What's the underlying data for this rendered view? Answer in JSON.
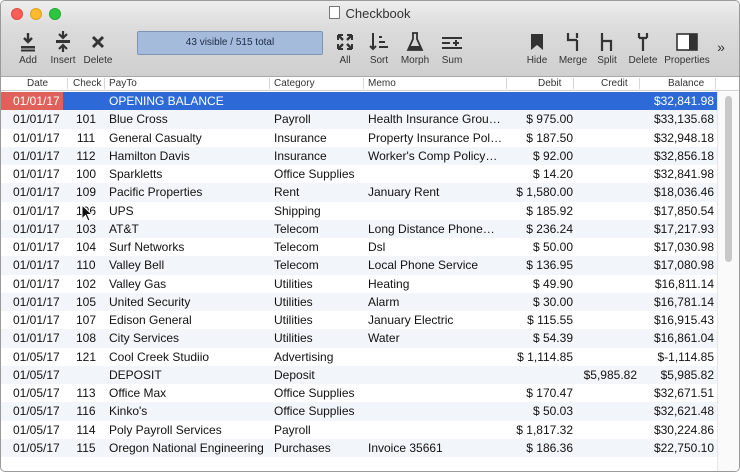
{
  "window": {
    "title": "Checkbook"
  },
  "toolbar": {
    "add": "Add",
    "insert": "Insert",
    "delete": "Delete",
    "status": "43 visible / 515 total",
    "all": "All",
    "sort": "Sort",
    "morph": "Morph",
    "sum": "Sum",
    "hide": "Hide",
    "merge": "Merge",
    "split": "Split",
    "delete2": "Delete",
    "properties": "Properties",
    "overflow": "»"
  },
  "columns": {
    "date": "Date",
    "check": "Check",
    "payto": "PayTo",
    "category": "Category",
    "memo": "Memo",
    "debit": "Debit",
    "credit": "Credit",
    "balance": "Balance"
  },
  "rows": [
    {
      "date": "01/01/17",
      "check": "",
      "payto": "OPENING BALANCE",
      "category": "",
      "memo": "",
      "debit": "",
      "credit": "",
      "balance": "$32,841.98"
    },
    {
      "date": "01/01/17",
      "check": "101",
      "payto": "Blue Cross",
      "category": "Payroll",
      "memo": "Health Insurance Grou…",
      "debit": "$ 975.00",
      "credit": "",
      "balance": "$33,135.68"
    },
    {
      "date": "01/01/17",
      "check": "111",
      "payto": "General Casualty",
      "category": "Insurance",
      "memo": "Property Insurance Pol…",
      "debit": "$ 187.50",
      "credit": "",
      "balance": "$32,948.18"
    },
    {
      "date": "01/01/17",
      "check": "112",
      "payto": "Hamilton Davis",
      "category": "Insurance",
      "memo": "Worker's Comp Policy…",
      "debit": "$ 92.00",
      "credit": "",
      "balance": "$32,856.18"
    },
    {
      "date": "01/01/17",
      "check": "100",
      "payto": "Sparkletts",
      "category": "Office Supplies",
      "memo": "",
      "debit": "$ 14.20",
      "credit": "",
      "balance": "$32,841.98"
    },
    {
      "date": "01/01/17",
      "check": "109",
      "payto": "Pacific Properties",
      "category": "Rent",
      "memo": "January Rent",
      "debit": "$ 1,580.00",
      "credit": "",
      "balance": "$18,036.46"
    },
    {
      "date": "01/01/17",
      "check": "106",
      "payto": "UPS",
      "category": "Shipping",
      "memo": "",
      "debit": "$ 185.92",
      "credit": "",
      "balance": "$17,850.54"
    },
    {
      "date": "01/01/17",
      "check": "103",
      "payto": "AT&T",
      "category": "Telecom",
      "memo": "Long Distance Phone…",
      "debit": "$ 236.24",
      "credit": "",
      "balance": "$17,217.93"
    },
    {
      "date": "01/01/17",
      "check": "104",
      "payto": "Surf Networks",
      "category": "Telecom",
      "memo": "Dsl",
      "debit": "$ 50.00",
      "credit": "",
      "balance": "$17,030.98"
    },
    {
      "date": "01/01/17",
      "check": "110",
      "payto": "Valley Bell",
      "category": "Telecom",
      "memo": "Local Phone Service",
      "debit": "$ 136.95",
      "credit": "",
      "balance": "$17,080.98"
    },
    {
      "date": "01/01/17",
      "check": "102",
      "payto": "Valley Gas",
      "category": "Utilities",
      "memo": "Heating",
      "debit": "$ 49.90",
      "credit": "",
      "balance": "$16,811.14"
    },
    {
      "date": "01/01/17",
      "check": "105",
      "payto": "United Security",
      "category": "Utilities",
      "memo": "Alarm",
      "debit": "$ 30.00",
      "credit": "",
      "balance": "$16,781.14"
    },
    {
      "date": "01/01/17",
      "check": "107",
      "payto": "Edison General",
      "category": "Utilities",
      "memo": "January Electric",
      "debit": "$ 115.55",
      "credit": "",
      "balance": "$16,915.43"
    },
    {
      "date": "01/01/17",
      "check": "108",
      "payto": "City Services",
      "category": "Utilities",
      "memo": "Water",
      "debit": "$ 54.39",
      "credit": "",
      "balance": "$16,861.04"
    },
    {
      "date": "01/05/17",
      "check": "121",
      "payto": "Cool Creek Studiio",
      "category": "Advertising",
      "memo": "",
      "debit": "$ 1,114.85",
      "credit": "",
      "balance": "$-1,114.85"
    },
    {
      "date": "01/05/17",
      "check": "",
      "payto": "DEPOSIT",
      "category": "Deposit",
      "memo": "",
      "debit": "",
      "credit": "$5,985.82",
      "balance": "$5,985.82"
    },
    {
      "date": "01/05/17",
      "check": "113",
      "payto": "Office Max",
      "category": "Office Supplies",
      "memo": "",
      "debit": "$ 170.47",
      "credit": "",
      "balance": "$32,671.51"
    },
    {
      "date": "01/05/17",
      "check": "116",
      "payto": "Kinko's",
      "category": "Office Supplies",
      "memo": "",
      "debit": "$ 50.03",
      "credit": "",
      "balance": "$32,621.48"
    },
    {
      "date": "01/05/17",
      "check": "114",
      "payto": "Poly Payroll Services",
      "category": "Payroll",
      "memo": "",
      "debit": "$ 1,817.32",
      "credit": "",
      "balance": "$30,224.86"
    },
    {
      "date": "01/05/17",
      "check": "115",
      "payto": "Oregon National Engineering",
      "category": "Purchases",
      "memo": "Invoice 35661",
      "debit": "$ 186.36",
      "credit": "",
      "balance": "$22,750.10"
    }
  ]
}
